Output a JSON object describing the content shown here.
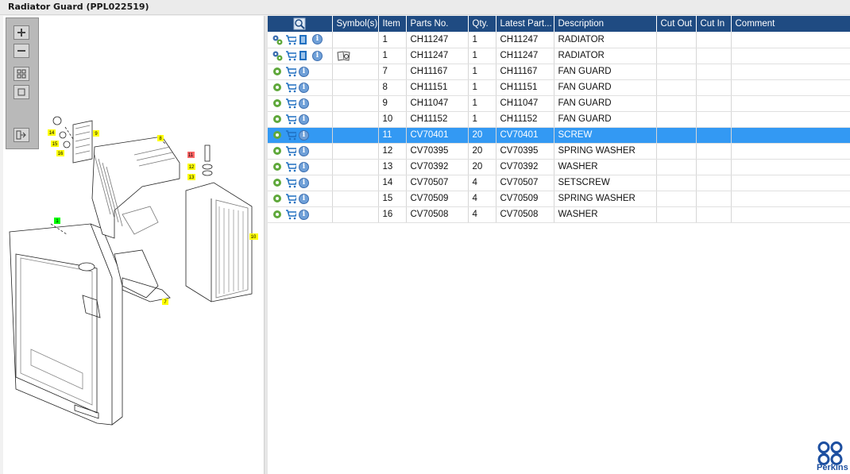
{
  "window": {
    "title": "Radiator Guard (PPL022519)"
  },
  "toolbar": {
    "zoom_in": "zoom-in",
    "zoom_out": "zoom-out",
    "fit": "fit-to-window",
    "actual": "actual-size",
    "export": "export"
  },
  "table": {
    "headers": {
      "search": "",
      "symbols": "Symbol(s)",
      "item": "Item",
      "parts_no": "Parts No.",
      "qty": "Qty.",
      "latest_part": "Latest Part...",
      "description": "Description",
      "cut_out": "Cut Out",
      "cut_in": "Cut In",
      "comment": "Comment"
    },
    "rows": [
      {
        "item": "1",
        "parts_no": "CH11247",
        "qty": "1",
        "latest": "CH11247",
        "desc": "RADIATOR",
        "symbol": ""
      },
      {
        "item": "1",
        "parts_no": "CH11247",
        "qty": "1",
        "latest": "CH11247",
        "desc": "RADIATOR",
        "symbol": "book-icon"
      },
      {
        "item": "7",
        "parts_no": "CH11167",
        "qty": "1",
        "latest": "CH11167",
        "desc": "FAN GUARD",
        "symbol": ""
      },
      {
        "item": "8",
        "parts_no": "CH11151",
        "qty": "1",
        "latest": "CH11151",
        "desc": "FAN GUARD",
        "symbol": ""
      },
      {
        "item": "9",
        "parts_no": "CH11047",
        "qty": "1",
        "latest": "CH11047",
        "desc": "FAN GUARD",
        "symbol": ""
      },
      {
        "item": "10",
        "parts_no": "CH11152",
        "qty": "1",
        "latest": "CH11152",
        "desc": "FAN GUARD",
        "symbol": ""
      },
      {
        "item": "11",
        "parts_no": "CV70401",
        "qty": "20",
        "latest": "CV70401",
        "desc": "SCREW",
        "symbol": ""
      },
      {
        "item": "12",
        "parts_no": "CV70395",
        "qty": "20",
        "latest": "CV70395",
        "desc": "SPRING WASHER",
        "symbol": ""
      },
      {
        "item": "13",
        "parts_no": "CV70392",
        "qty": "20",
        "latest": "CV70392",
        "desc": "WASHER",
        "symbol": ""
      },
      {
        "item": "14",
        "parts_no": "CV70507",
        "qty": "4",
        "latest": "CV70507",
        "desc": "SETSCREW",
        "symbol": ""
      },
      {
        "item": "15",
        "parts_no": "CV70509",
        "qty": "4",
        "latest": "CV70509",
        "desc": "SPRING WASHER",
        "symbol": ""
      },
      {
        "item": "16",
        "parts_no": "CV70508",
        "qty": "4",
        "latest": "CV70508",
        "desc": "WASHER",
        "symbol": ""
      }
    ],
    "selected_row": 6
  },
  "diagram": {
    "callouts": [
      "14",
      "15",
      "16",
      "9",
      "8",
      "11",
      "12",
      "13",
      "1",
      "10",
      "7"
    ]
  },
  "logo": {
    "text": "Perkins"
  },
  "colors": {
    "header_bg": "#1f4b82",
    "selected_row": "#3399f3",
    "callout_yellow": "#ffff00",
    "callout_green": "#00ff00",
    "callout_red": "#ff6666"
  }
}
